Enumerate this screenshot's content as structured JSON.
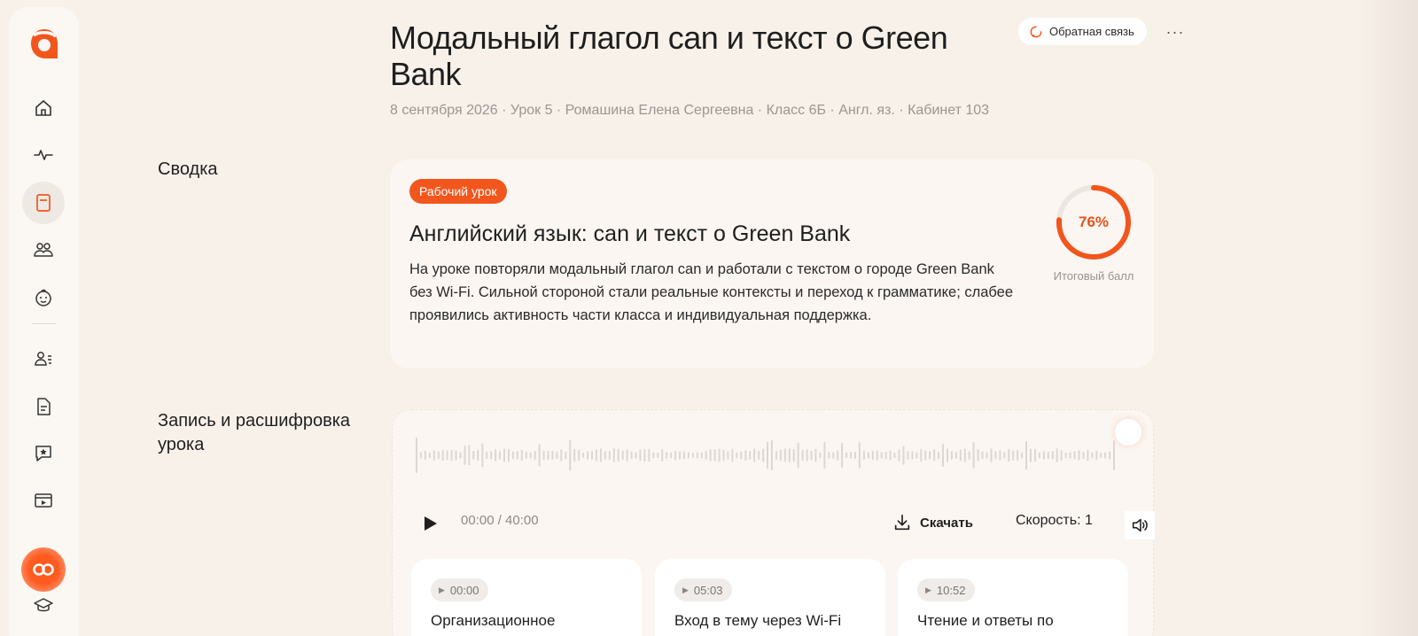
{
  "colors": {
    "accent": "#f2561d",
    "background": "#f8f1ea",
    "card": "#fbf6f2"
  },
  "sidebar": {
    "logo_icon": "brand-logo-icon",
    "items": [
      {
        "name": "home",
        "icon": "home-icon",
        "active": false
      },
      {
        "name": "pulse",
        "icon": "pulse-icon",
        "active": false
      },
      {
        "name": "lessons",
        "icon": "book-icon",
        "active": true
      },
      {
        "name": "groups",
        "icon": "users-icon",
        "active": false
      },
      {
        "name": "children",
        "icon": "child-face-icon",
        "active": false
      },
      {
        "name": "profiles",
        "icon": "user-list-icon",
        "active": false
      },
      {
        "name": "documents",
        "icon": "document-icon",
        "active": false
      },
      {
        "name": "reviews",
        "icon": "star-message-icon",
        "active": false
      },
      {
        "name": "tutorials",
        "icon": "video-icon",
        "active": false
      },
      {
        "name": "assistant",
        "icon": "assistant-icon",
        "active": false
      },
      {
        "name": "education",
        "icon": "graduation-cap-icon",
        "active": false
      }
    ]
  },
  "header": {
    "title": "Модальный глагол can и текст о Green Bank",
    "meta": "8 сентября 2026 · Урок 5 · Ромашина Елена Сергеевна · Класс 6Б · Англ. яз. · Кабинет 103",
    "feedback_label": "Обратная связь",
    "more_label": "···"
  },
  "summary": {
    "section_label": "Сводка",
    "badge": "Рабочий урок",
    "title": "Английский язык: can и текст о Green Bank",
    "text": "На уроке повторяли модальный глагол can и работали с текстом о городе Green Bank без Wi-Fi. Сильной стороной стали реальные контексты и переход к грамматике; слабее проявились активность части класса и индивидуальная поддержка.",
    "score_text": "76%",
    "score_value": 76,
    "score_label": "Итоговый балл"
  },
  "recording": {
    "section_label": "Запись и расшифровка урока",
    "time": "00:00 / 40:00",
    "download_label": "Скачать",
    "speed_label": "Скорость: 1",
    "chapters": [
      {
        "time": "00:00",
        "title": "Организационное"
      },
      {
        "time": "05:03",
        "title": "Вход в тему через Wi-Fi"
      },
      {
        "time": "10:52",
        "title": "Чтение и ответы по"
      }
    ]
  }
}
